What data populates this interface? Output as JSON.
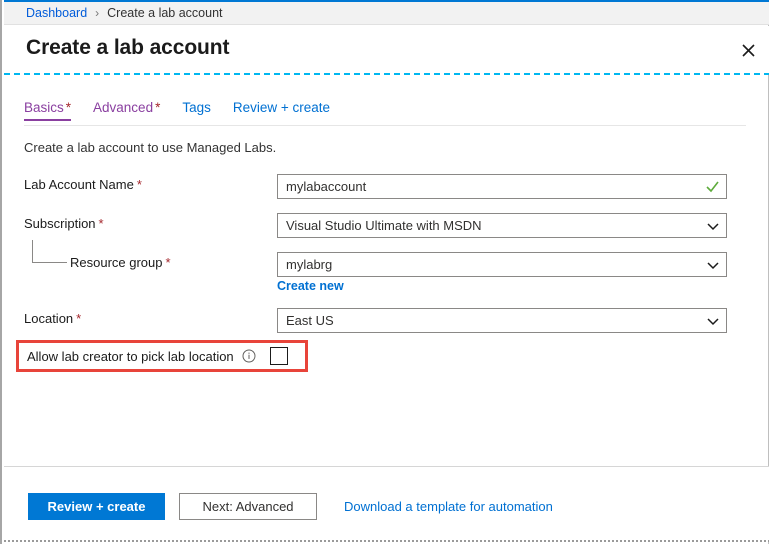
{
  "breadcrumb": {
    "root": "Dashboard",
    "separator": "›",
    "current": "Create a lab account"
  },
  "header": {
    "title": "Create a lab account",
    "close_icon": "close-icon"
  },
  "tabs": [
    {
      "label": "Basics",
      "required_mark": "*",
      "state": "active"
    },
    {
      "label": "Advanced",
      "required_mark": "*",
      "state": "purple"
    },
    {
      "label": "Tags",
      "required_mark": "",
      "state": "link"
    },
    {
      "label": "Review + create",
      "required_mark": "",
      "state": "link"
    }
  ],
  "description": "Create a lab account to use Managed Labs.",
  "form": {
    "lab_account_name": {
      "label": "Lab Account Name",
      "required_mark": "*",
      "value": "mylabaccount",
      "validation_icon": "check-icon"
    },
    "subscription": {
      "label": "Subscription",
      "required_mark": "*",
      "value": "Visual Studio Ultimate with MSDN",
      "dropdown_icon": "chevron-down-icon"
    },
    "resource_group": {
      "label": "Resource group",
      "required_mark": "*",
      "value": "mylabrg",
      "dropdown_icon": "chevron-down-icon",
      "create_new_link": "Create new"
    },
    "location": {
      "label": "Location",
      "required_mark": "*",
      "value": "East US",
      "dropdown_icon": "chevron-down-icon"
    },
    "allow_lab_creator": {
      "label": "Allow lab creator to pick lab location",
      "info_icon": "info-icon",
      "checked": false
    }
  },
  "footer": {
    "review_create_button": "Review + create",
    "next_button": "Next: Advanced",
    "download_link": "Download a template for automation"
  },
  "colors": {
    "accent_blue": "#0078d4",
    "link_blue": "#0070d2",
    "tab_purple": "#8a3fa0",
    "required_red": "#a4262c",
    "highlight_red": "#e8443a",
    "validation_green": "#5eab3c",
    "dashed_cyan": "#00b7f0"
  }
}
